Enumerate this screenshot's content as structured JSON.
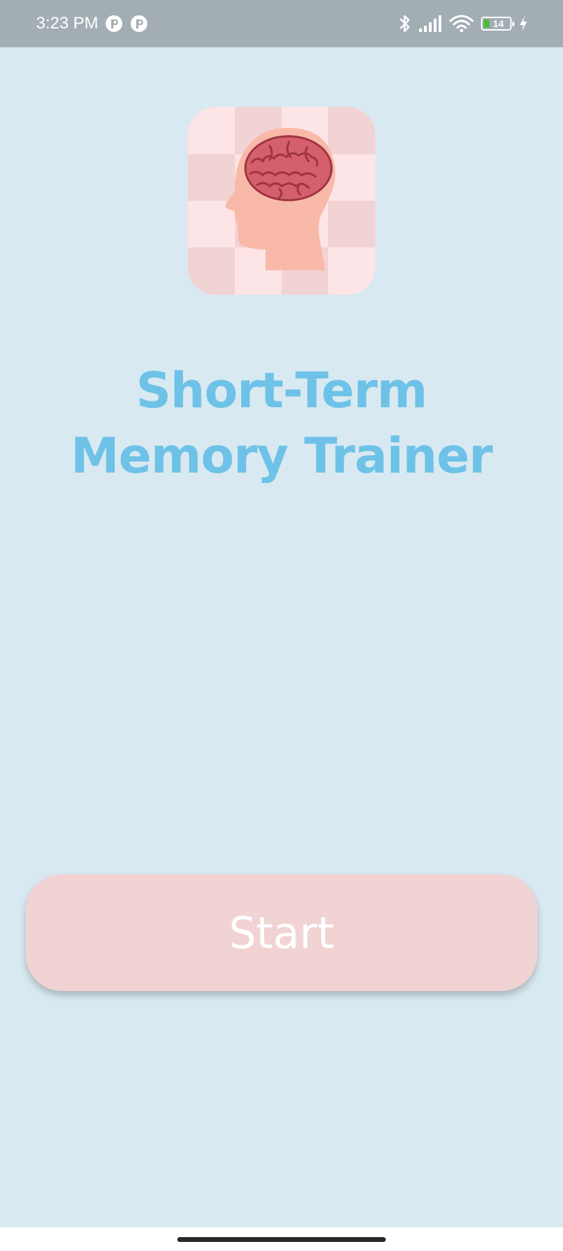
{
  "status_bar": {
    "time": "3:23 PM",
    "battery_level": "14",
    "icons": [
      "app-notification-icon",
      "app-notification-icon",
      "bluetooth-icon",
      "signal-icon",
      "wifi-icon",
      "battery-icon",
      "charging-icon"
    ]
  },
  "app": {
    "icon": "brain-head-icon",
    "title": "Short-Term Memory Trainer",
    "start_label": "Start"
  },
  "colors": {
    "background": "#d9e9f1",
    "title": "#6ec2e7",
    "button": "#f1d3d4",
    "status_bar": "#a3adb4"
  }
}
